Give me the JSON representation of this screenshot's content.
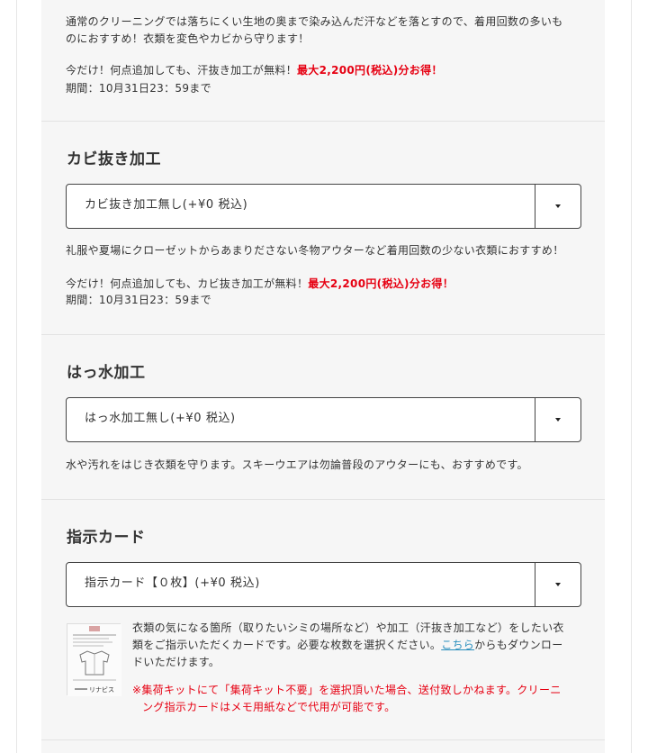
{
  "sweat": {
    "desc_line1": "通常のクリーニングでは落ちにくい生地の奥まで染み込んだ汗などを落とすので、着用回数の多いも",
    "desc_line2": "のにおすすめ！衣類を変色やカビから守ります！",
    "promo_text": "今だけ！何点追加しても、汗抜き加工が無料！",
    "promo_highlight": "最大2,200円(税込)分お得！",
    "period": "期間：10月31日23：59まで"
  },
  "mold": {
    "title": "カビ抜き加工",
    "select_value": "カビ抜き加工無し(+¥0 税込)",
    "desc": "礼服や夏場にクローゼットからあまりださない冬物アウターなど着用回数の少ない衣類におすすめ！",
    "promo_text": "今だけ！何点追加しても、カビ抜き加工が無料！",
    "promo_highlight": "最大2,200円(税込)分お得！",
    "period": "期間：10月31日23：59まで"
  },
  "water": {
    "title": "はっ水加工",
    "select_value": "はっ水加工無し(+¥0 税込)",
    "desc": "水や汚れをはじき衣類を守ります。スキーウエアは勿論普段のアウターにも、おすすめです。"
  },
  "card": {
    "title": "指示カード",
    "select_value": "指示カード【０枚】(+¥0 税込)",
    "desc_line1": "衣類の気になる箇所（取りたいシミの場所など）や加工（汗抜き加工など）をしたい衣",
    "desc_line2_before": "類をご指示いただくカードです。必要な枚数を選択ください。",
    "desc_link": "こちら",
    "desc_line2_after": "からもダウンロー",
    "desc_line3": "ドいただけます。",
    "warning_line1": "※集荷キットにて「集荷キット不要」を選択頂いた場合、送付致しかねます。クリーニ",
    "warning_line2": "ング指示カードはメモ用紙などで代用が可能です。",
    "image_brand": "リナビス"
  },
  "colors": {
    "accent_red": "#e60012",
    "link_blue": "#2a8fbd",
    "panel_bg": "#f6f6f6"
  }
}
